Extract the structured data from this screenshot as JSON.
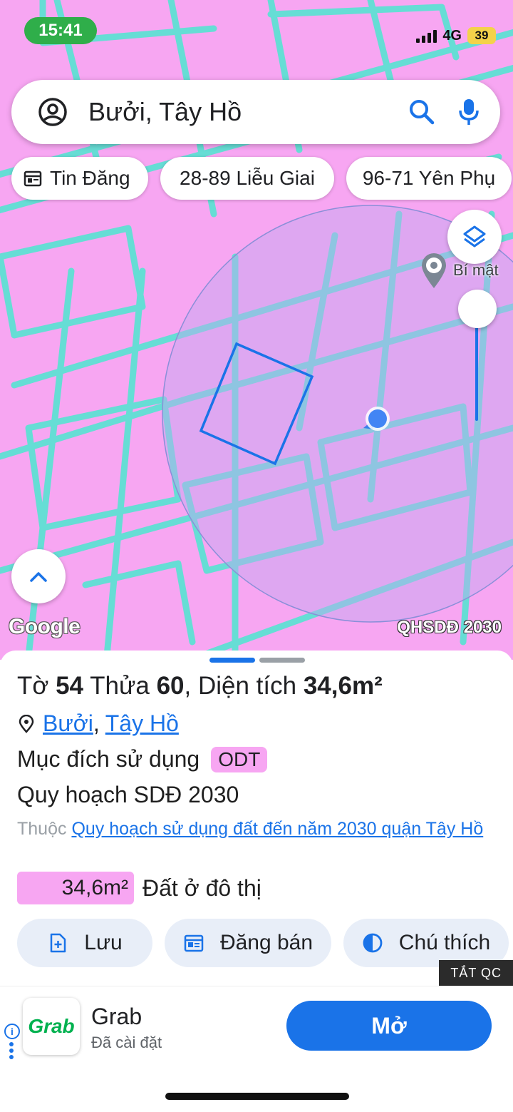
{
  "status_bar": {
    "time": "15:41",
    "network": "4G",
    "battery": "39"
  },
  "search": {
    "query": "Bưởi, Tây Hồ"
  },
  "chips": [
    {
      "label": "Tin Đăng"
    },
    {
      "label": "28-89 Liễu Giai"
    },
    {
      "label": "96-71 Yên Phụ"
    }
  ],
  "map": {
    "poi_label": "Bí mật",
    "logo": "Google",
    "layer_tag": "QHSDĐ 2030",
    "colors": {
      "land": "#f7a6f2",
      "roads": "#5fe0d4",
      "accent": "#1a73e8"
    }
  },
  "sheet": {
    "title": {
      "sheet_prefix": "Tờ",
      "sheet_no": "54",
      "parcel_prefix": "Thửa",
      "parcel_no": "60",
      "area_prefix": ", Diện tích",
      "area": "34,6m²"
    },
    "ward": "Bưởi",
    "separator": ",",
    "district": "Tây Hồ",
    "purpose_label": "Mục đích sử dụng",
    "purpose_code": "ODT",
    "plan_label": "Quy hoạch SDĐ 2030",
    "source_prefix": "Thuộc",
    "source_link": "Quy hoạch sử dụng đất đến năm 2030 quận Tây Hồ",
    "area_chip": "34,6m²",
    "area_desc": "Đất ở đô thị",
    "actions": [
      {
        "label": "Lưu",
        "icon": "add-file-icon"
      },
      {
        "label": "Đăng bán",
        "icon": "calendar-icon"
      },
      {
        "label": "Chú thích",
        "icon": "contrast-icon"
      }
    ]
  },
  "ad": {
    "off_label": "TẮT QC",
    "info": "i",
    "app_logo": "Grab",
    "app_name": "Grab",
    "app_status": "Đã cài đặt",
    "open_label": "Mở"
  }
}
